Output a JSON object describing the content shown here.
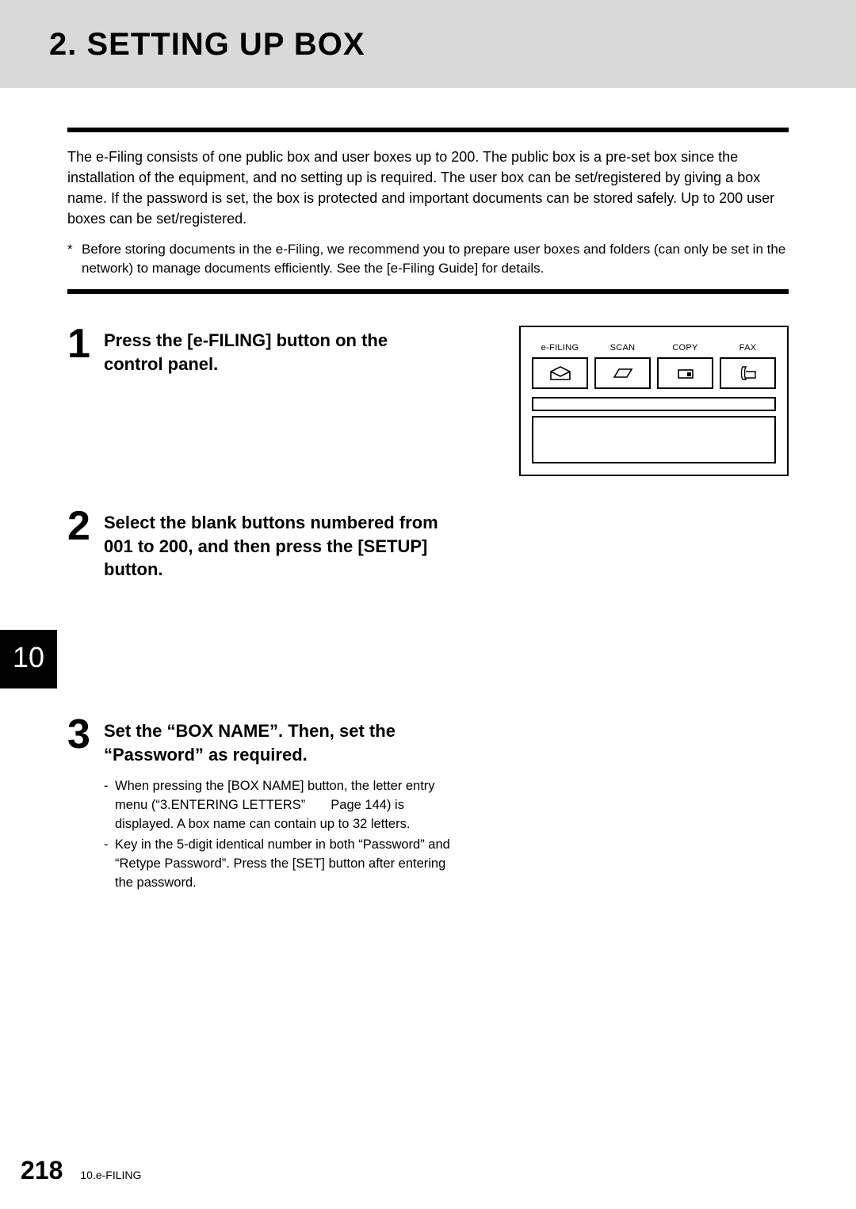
{
  "header": {
    "title": "2. SETTING UP BOX"
  },
  "intro": "The e-Filing consists of one public box and user boxes up to 200. The public box is a pre-set box since the installation of the equipment, and no setting up is required. The user box can be set/registered by giving a box name. If the password is set, the box is protected and important documents can be stored safely. Up to 200 user boxes can be set/registered.",
  "note": {
    "star": "*",
    "text": "Before storing documents in the e-Filing, we recommend you to prepare user boxes and folders (can only be set in the network) to manage documents efficiently. See the [e-Filing Guide] for details."
  },
  "steps": {
    "s1": {
      "num": "1",
      "title": "Press the [e-FILING] button on the control panel."
    },
    "s2": {
      "num": "2",
      "title": "Select the blank buttons numbered from 001 to 200, and then press the [SETUP] button."
    },
    "s3": {
      "num": "3",
      "title": "Set the “BOX NAME”. Then, set the “Password” as required.",
      "d1": "When pressing the [BOX NAME] button, the letter entry menu (“3.ENTERING LETTERS”       Page 144) is displayed. A box name can contain up to 32 letters.",
      "d2": "Key in the 5-digit identical number in both “Password” and “Retype Password”. Press the [SET] button after entering the password."
    }
  },
  "panel": {
    "b1": "e-FILING",
    "b2": "SCAN",
    "b3": "COPY",
    "b4": "FAX"
  },
  "chapter_tab": "10",
  "footer": {
    "page": "218",
    "section": "10.e-FILING"
  }
}
